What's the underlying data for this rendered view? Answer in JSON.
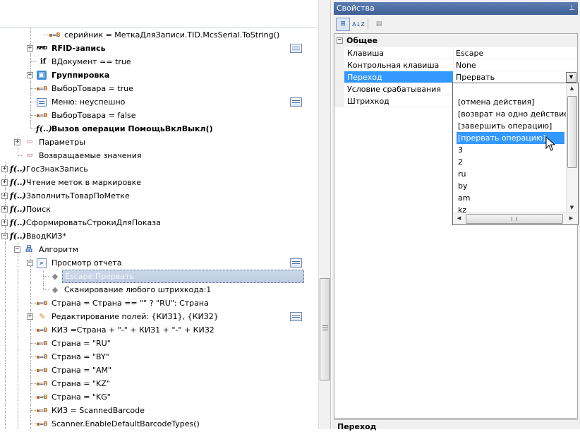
{
  "tree": {
    "rows": [
      {
        "label": "серийник = МеткаДляЗаписи.TID.McsSerial.ToString()",
        "icon": "assign",
        "bold": false
      },
      {
        "label": "RFID-запись",
        "icon": "rfid",
        "bold": true
      },
      {
        "label": "ВДокумент == true",
        "icon": "if",
        "bold": false
      },
      {
        "label": "Группировка",
        "icon": "group",
        "bold": true
      },
      {
        "label": "ВыборТовара = true",
        "icon": "assign",
        "bold": false
      },
      {
        "label": "Меню: неуспешно",
        "icon": "menu",
        "bold": false
      },
      {
        "label": "ВыборТовара = false",
        "icon": "assign",
        "bold": false
      },
      {
        "label": "Вызов операции ПомощьВклВыкл()",
        "icon": "func",
        "bold": true
      },
      {
        "label": "Параметры",
        "icon": "param",
        "bold": false
      },
      {
        "label": "Возвращаемые значения",
        "icon": "param",
        "bold": false
      },
      {
        "label": "ГосЗнакЗапись",
        "icon": "func",
        "bold": false
      },
      {
        "label": "Чтение меток в маркировке",
        "icon": "func",
        "bold": false
      },
      {
        "label": "ЗаполнитьТоварПоМетке",
        "icon": "func",
        "bold": false
      },
      {
        "label": "Поиск",
        "icon": "func",
        "bold": false
      },
      {
        "label": "СформироватьСтрокиДляПоказа",
        "icon": "func",
        "bold": false
      },
      {
        "label": "ВводКИЗ*",
        "icon": "func",
        "bold": false
      },
      {
        "label": "Алгоритм",
        "icon": "algo",
        "bold": false
      },
      {
        "label": "Просмотр отчета",
        "icon": "report",
        "bold": false
      },
      {
        "label": "Escape:Прервать",
        "icon": "key",
        "bold": false
      },
      {
        "label": "Сканирование любого штрихкода:1",
        "icon": "key",
        "bold": false
      },
      {
        "label": "Страна = Страна == \"\" ? \"RU\": Страна",
        "icon": "assign",
        "bold": false
      },
      {
        "label": "Редактирование полей: {КИЗ1}, {КИЗ2}",
        "icon": "edit",
        "bold": false
      },
      {
        "label": "КИЗ =Страна + \"-\" + КИЗ1 + \"-\" + КИЗ2",
        "icon": "assign",
        "bold": false
      },
      {
        "label": "Страна = \"RU\"",
        "icon": "assign",
        "bold": false
      },
      {
        "label": "Страна = \"BY\"",
        "icon": "assign",
        "bold": false
      },
      {
        "label": "Страна = \"AM\"",
        "icon": "assign",
        "bold": false
      },
      {
        "label": "Страна = \"KZ\"",
        "icon": "assign",
        "bold": false
      },
      {
        "label": "Страна = \"KG\"",
        "icon": "assign",
        "bold": false
      },
      {
        "label": "КИЗ = ScannedBarcode",
        "icon": "assign",
        "bold": false
      },
      {
        "label": "Scanner.EnableDefaultBarcodeTypes()",
        "icon": "assign",
        "bold": false
      }
    ]
  },
  "props": {
    "title": "Свойства",
    "pin": "⊥",
    "toolbar": {
      "categorized": "⊞",
      "alphabetical": "A↓Z",
      "pages": "▤"
    },
    "category": "Общее",
    "category_expander": "−",
    "rows": [
      {
        "name": "Клавиша",
        "value": "Escape"
      },
      {
        "name": "Контрольная клавиша",
        "value": "None"
      },
      {
        "name": "Переход",
        "value": "Прервать"
      },
      {
        "name": "Условие срабатывания",
        "value": ""
      },
      {
        "name": "Штрихкод",
        "value": ""
      }
    ],
    "dropdown_arrow": "▼",
    "description_title": "Переход"
  },
  "dropdown": {
    "items": [
      "[отмена действия]",
      "[возврат на одно действие]",
      "[завершить операцию]",
      "[прервать операцию]",
      "3",
      "2",
      "ru",
      "by",
      "am",
      "kz"
    ],
    "highlighted_index": 3,
    "arrows": {
      "up": "▲",
      "down": "▼",
      "left": "◀",
      "right": "▶"
    }
  },
  "colors": {
    "selection": "#3399ff",
    "titlebar": "#4a6ca3"
  }
}
